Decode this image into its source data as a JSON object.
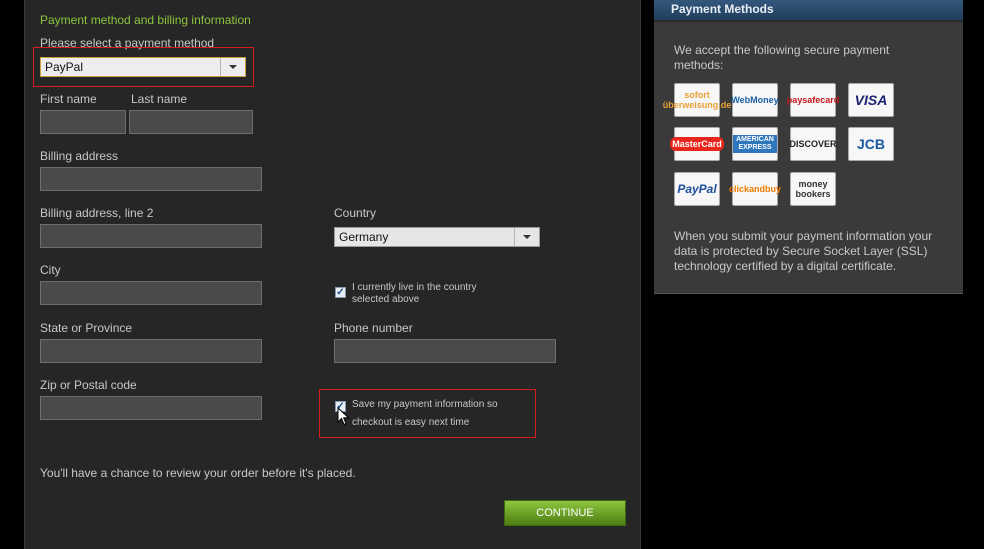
{
  "form": {
    "section_title": "Payment method and billing information",
    "payment_method_label": "Please select a payment method",
    "payment_method_value": "PayPal",
    "first_name_label": "First name",
    "last_name_label": "Last name",
    "billing_address_label": "Billing address",
    "billing_address2_label": "Billing address, line 2",
    "country_label": "Country",
    "country_value": "Germany",
    "city_label": "City",
    "live_in_country_label": "I currently live in the country selected above",
    "state_label": "State or Province",
    "phone_label": "Phone number",
    "zip_label": "Zip or Postal code",
    "save_payment_line1": "Save my payment information so",
    "save_payment_line2": "checkout is easy next time",
    "review_note": "You'll have a chance to review your order before it's placed.",
    "continue_label": "CONTINUE"
  },
  "sidebar": {
    "header": "Payment Methods",
    "intro": "We accept the following secure payment methods:",
    "ssl_note": "When you submit your payment information your data is protected by Secure Socket Layer (SSL) technology certified by a digital certificate.",
    "payment_logos": [
      {
        "name": "sofort-icon",
        "text": "sofort überweisung.de",
        "color": "#e8a036"
      },
      {
        "name": "webmoney-icon",
        "text": "WebMoney",
        "color": "#1a5fa5"
      },
      {
        "name": "paysafecard-icon",
        "text": "paysafecard",
        "color": "#c4161c"
      },
      {
        "name": "visa-icon",
        "text": "VISA",
        "color": "#1a1f71"
      },
      {
        "name": "mastercard-icon",
        "text": "MasterCard",
        "color": "#e8261c"
      },
      {
        "name": "amex-icon",
        "text": "AMERICAN EXPRESS",
        "color": "#2e77bc"
      },
      {
        "name": "discover-icon",
        "text": "DISCOVER",
        "color": "#222222"
      },
      {
        "name": "jcb-icon",
        "text": "JCB",
        "color": "#1b5a9e"
      },
      {
        "name": "paypal-icon",
        "text": "PayPal",
        "color": "#1d4e9a"
      },
      {
        "name": "clickandbuy-icon",
        "text": "clickandbuy",
        "color": "#f07d00"
      },
      {
        "name": "moneybookers-icon",
        "text": "money bookers",
        "color": "#333333"
      }
    ]
  }
}
